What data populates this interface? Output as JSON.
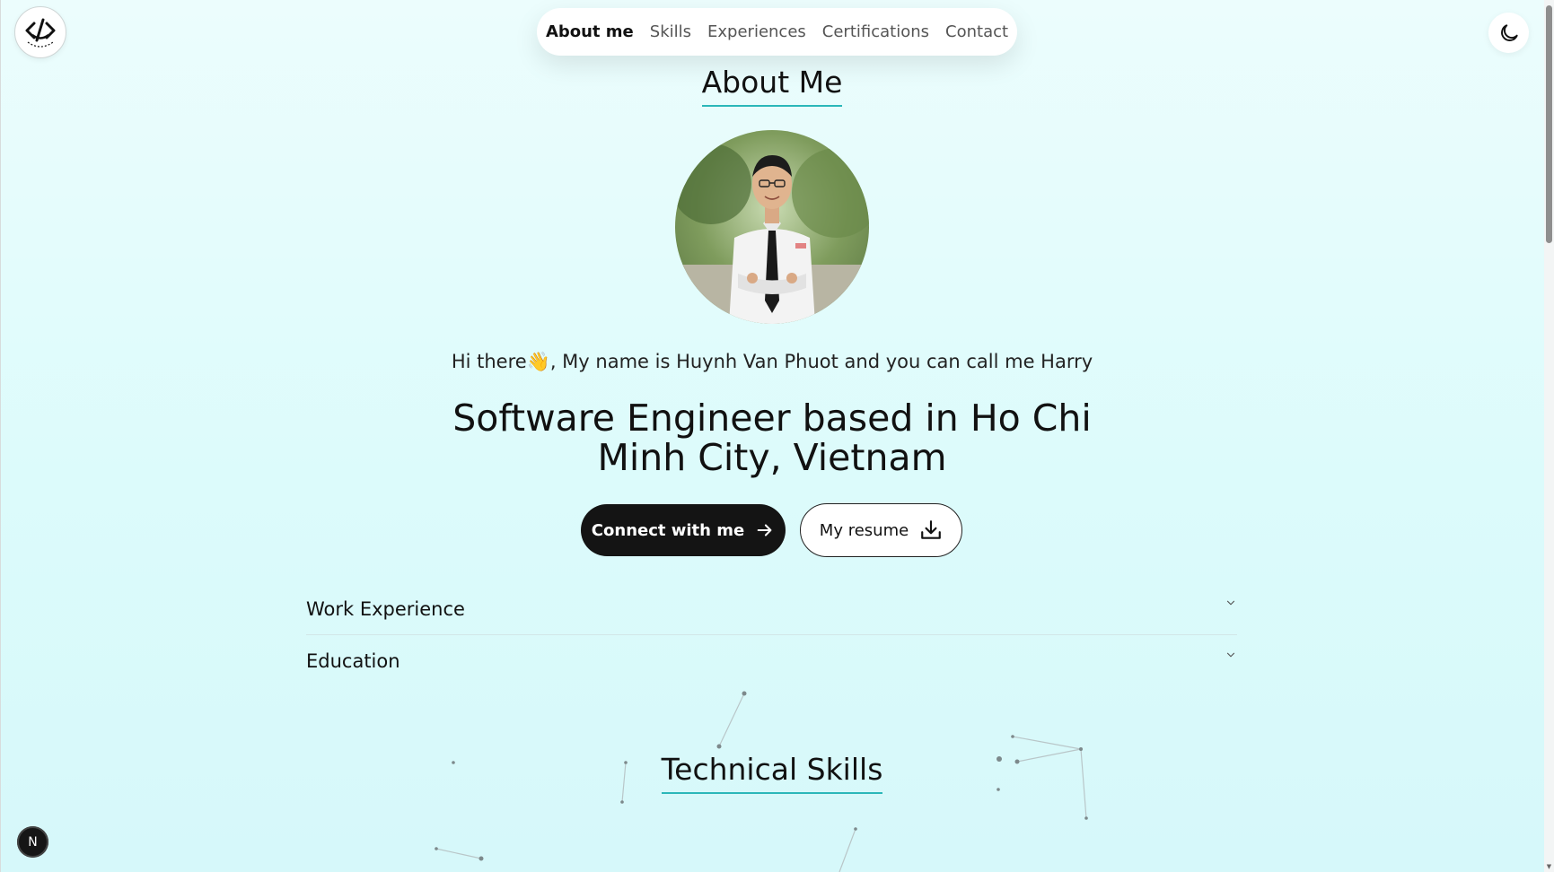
{
  "logo": {
    "name": "logo-icon"
  },
  "nav": {
    "items": [
      {
        "label": "About me",
        "active": true
      },
      {
        "label": "Skills",
        "active": false
      },
      {
        "label": "Experiences",
        "active": false
      },
      {
        "label": "Certifications",
        "active": false
      },
      {
        "label": "Contact",
        "active": false
      }
    ]
  },
  "theme_toggle": {
    "icon": "moon-icon"
  },
  "about": {
    "title": "About Me",
    "greeting_prefix": "Hi there",
    "greeting_emoji": "👋",
    "greeting_rest": ", My name is Huynh Van Phuot and you can call me Harry",
    "headline": "Software Engineer based in Ho Chi Minh City, Vietnam",
    "connect_label": "Connect with me",
    "resume_label": "My resume"
  },
  "accordion": [
    {
      "label": "Work Experience"
    },
    {
      "label": "Education"
    }
  ],
  "skills": {
    "title": "Technical Skills"
  },
  "dev_badge": {
    "label": "N"
  },
  "colors": {
    "accent": "#2bb7b9",
    "button_dark": "#141414"
  }
}
